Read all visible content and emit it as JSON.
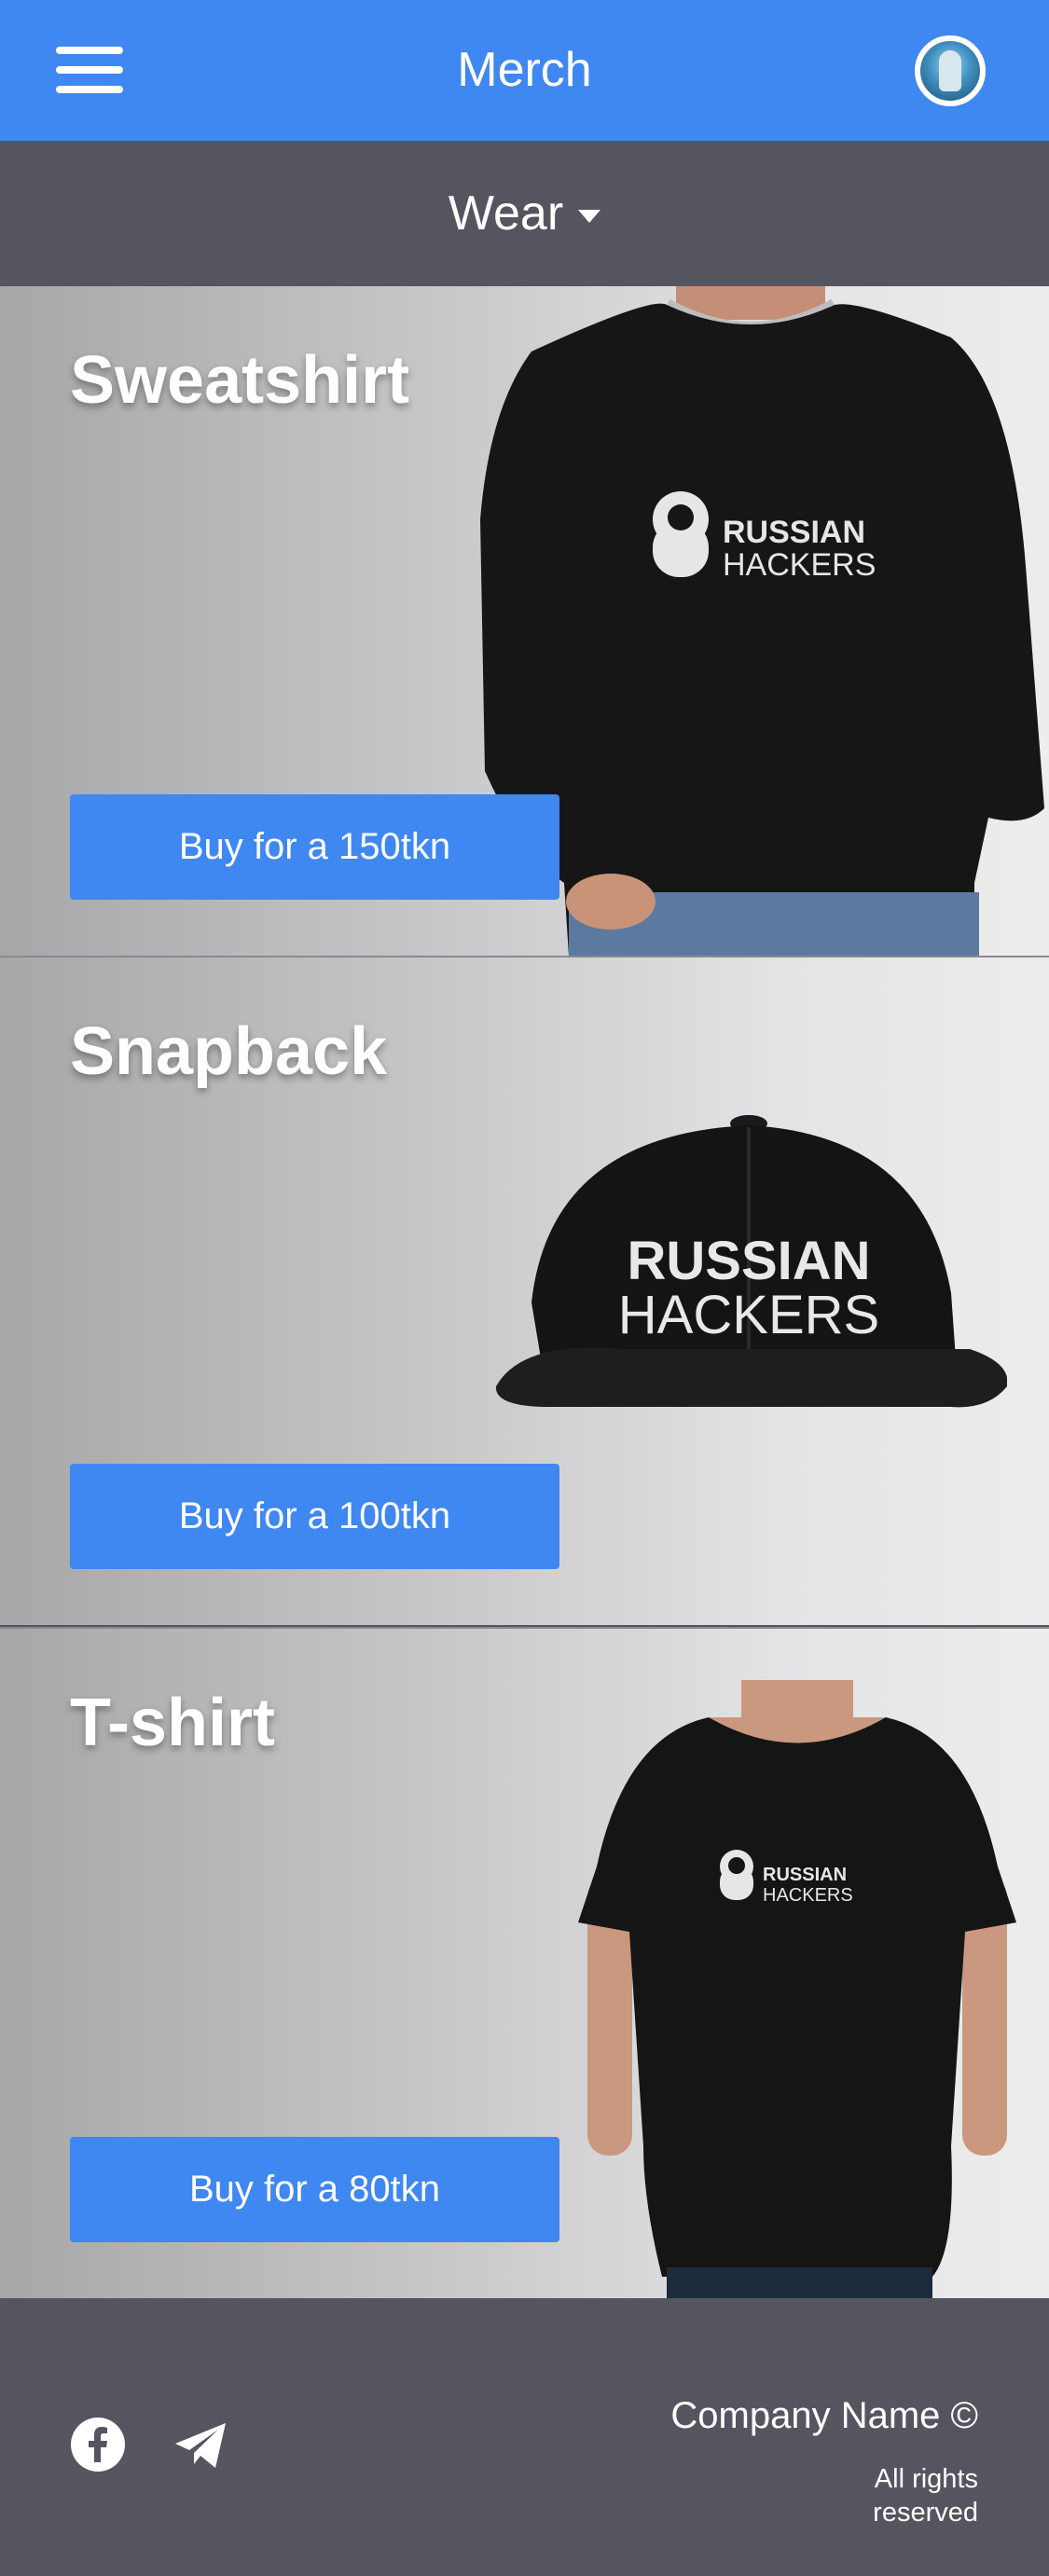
{
  "header": {
    "title": "Merch",
    "menu_icon": "hamburger-menu-icon",
    "avatar_icon": "user-avatar"
  },
  "category": {
    "selected": "Wear",
    "icon": "caret-down-icon"
  },
  "products": [
    {
      "title": "Sweatshirt",
      "buy_label": "Buy for a 150tkn",
      "image": "sweatshirt-image",
      "print_line1": "RUSSIAN",
      "print_line2": "HACKERS"
    },
    {
      "title": "Snapback",
      "buy_label": "Buy for a 100tkn",
      "image": "snapback-image",
      "print_line1": "RUSSIAN",
      "print_line2": "HACKERS"
    },
    {
      "title": "T-shirt",
      "buy_label": "Buy for a 80tkn",
      "image": "tshirt-image",
      "print_line1": "RUSSIAN",
      "print_line2": "HACKERS"
    }
  ],
  "footer": {
    "company": "Company Name ©",
    "rights": "All rights reserved",
    "social": [
      "facebook-icon",
      "telegram-icon"
    ]
  },
  "colors": {
    "primary": "#3f87f1",
    "bar": "#55555f",
    "white": "#ffffff"
  }
}
